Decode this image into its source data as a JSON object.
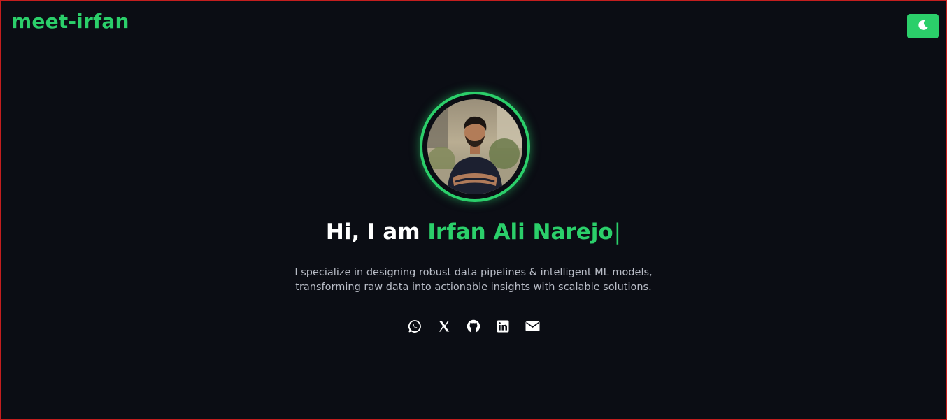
{
  "header": {
    "logo_text": "meet-irfan",
    "theme_toggle_icon": "moon-icon"
  },
  "hero": {
    "avatar_icon": "profile-photo",
    "greeting": "Hi, I am ",
    "name": "Irfan Ali Narejo",
    "cursor": "|",
    "tagline": "I specialize in designing robust data pipelines & intelligent ML models, transforming raw data into actionable insights with scalable solutions."
  },
  "socials": [
    {
      "icon": "whatsapp-icon"
    },
    {
      "icon": "x-icon"
    },
    {
      "icon": "github-icon"
    },
    {
      "icon": "linkedin-icon"
    },
    {
      "icon": "email-icon"
    }
  ],
  "colors": {
    "background": "#0b0d14",
    "accent": "#2bcf6a",
    "text": "#ffffff",
    "muted": "#b8bcc6"
  }
}
